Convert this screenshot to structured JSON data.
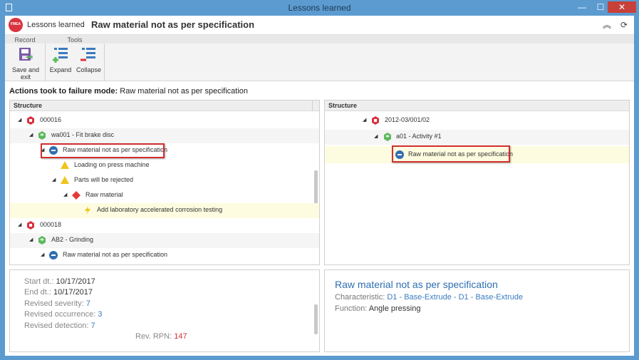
{
  "window": {
    "title": "Lessons learned"
  },
  "header": {
    "logo_text": "FMEA",
    "breadcrumb": "Lessons learned",
    "title": "Raw material not as per specification"
  },
  "ribbon": {
    "groups": {
      "record": "Record",
      "tools": "Tools"
    },
    "save_exit": "Save and exit",
    "expand": "Expand",
    "collapse": "Collapse"
  },
  "section": {
    "label": "Actions took to failure mode:",
    "value": "Raw material not as per specification"
  },
  "left_tree": {
    "header": "Structure",
    "rows": [
      {
        "text": "000016",
        "icon": "fmea-icon"
      },
      {
        "text": "wa001 - Fit brake disc",
        "icon": "item-icon"
      },
      {
        "text": "Raw material not as per specification",
        "icon": "failure-mode-icon"
      },
      {
        "text": "Loading on press machine",
        "icon": "effect-icon"
      },
      {
        "text": "Parts will be rejected",
        "icon": "effect-icon"
      },
      {
        "text": "Raw material",
        "icon": "cause-icon"
      },
      {
        "text": "Add laboratory accelerated corrosion testing",
        "icon": "action-icon"
      },
      {
        "text": "000018",
        "icon": "fmea-icon"
      },
      {
        "text": "AB2 - Grinding",
        "icon": "item-icon"
      },
      {
        "text": "Raw material not as per specification",
        "icon": "failure-mode-icon"
      }
    ]
  },
  "right_tree": {
    "header": "Structure",
    "rows": [
      {
        "text": "2012-03/001/02",
        "icon": "fmea-icon"
      },
      {
        "text": "a01 - Activity #1",
        "icon": "item-icon"
      },
      {
        "text": "Raw material not as per specification",
        "icon": "failure-mode-icon"
      }
    ]
  },
  "details": {
    "start_label": "Start dt.:",
    "start_value": "10/17/2017",
    "end_label": "End dt.:",
    "end_value": "10/17/2017",
    "severity_label": "Revised severity:",
    "severity_value": "7",
    "occurrence_label": "Revised occurrence:",
    "occurrence_value": "3",
    "detection_label": "Revised detection:",
    "detection_value": "7",
    "rpn_label": "Rev. RPN:",
    "rpn_value": "147"
  },
  "info": {
    "title": "Raw material not as per specification",
    "characteristic_label": "Characteristic:",
    "characteristic_value": "D1 - Base-Extrude - D1 - Base-Extrude",
    "function_label": "Function:",
    "function_value": "Angle pressing"
  },
  "colors": {
    "accent": "#2f6fb0",
    "highlight_border": "#d32f2f",
    "fmea_red": "#d9333f",
    "item_green": "#5cb85c",
    "warn_yellow": "#f0c419"
  }
}
